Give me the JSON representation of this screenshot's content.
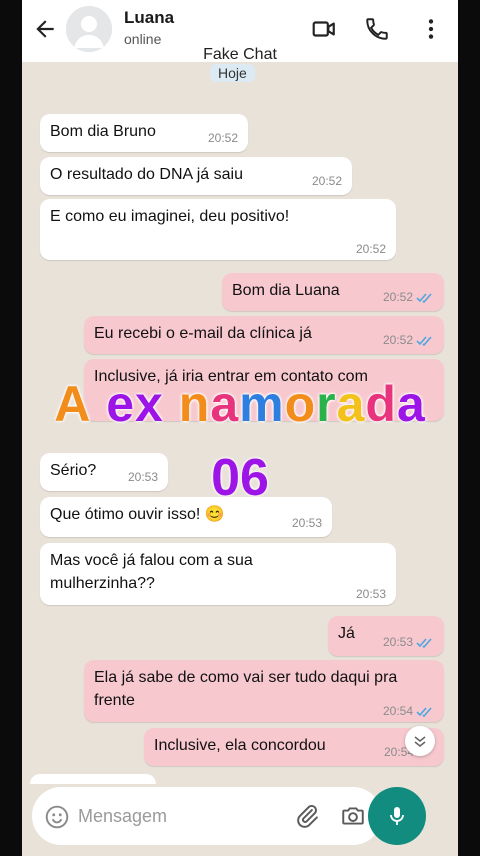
{
  "header": {
    "contact_name": "Luana",
    "status": "online",
    "subtitle": "Fake Chat"
  },
  "date_label": "Hoje",
  "messages": [
    {
      "text": "Bom dia Bruno",
      "time": "20:52",
      "direction": "in"
    },
    {
      "text": "O resultado do DNA já saiu",
      "time": "20:52",
      "direction": "in"
    },
    {
      "text": "E como eu imaginei, deu positivo!",
      "time": "20:52",
      "direction": "in"
    },
    {
      "text": "Bom dia Luana",
      "time": "20:52",
      "direction": "out",
      "read": true
    },
    {
      "text": "Eu recebi o e-mail da clínica já",
      "time": "20:52",
      "direction": "out",
      "read": true
    },
    {
      "text": "Inclusive, já iria entrar em contato com",
      "time": "",
      "direction": "out"
    },
    {
      "text": "Sério?",
      "time": "20:53",
      "direction": "in"
    },
    {
      "text": "Que ótimo ouvir isso! 😊",
      "time": "20:53",
      "direction": "in"
    },
    {
      "text": "Mas você já falou com a sua mulherzinha??",
      "time": "20:53",
      "direction": "in"
    },
    {
      "text": "Já",
      "time": "20:53",
      "direction": "out",
      "read": true
    },
    {
      "text": "Ela já sabe de como vai ser tudo daqui pra frente",
      "time": "20:54",
      "direction": "out",
      "read": true
    },
    {
      "text": "Inclusive, ela concordou",
      "time": "20:54",
      "direction": "out"
    }
  ],
  "overlay": {
    "title_letters": [
      {
        "char": "A",
        "color": "#f28c1a"
      },
      {
        "char": " ",
        "color": "#ffffff"
      },
      {
        "char": "e",
        "color": "#9d14e6"
      },
      {
        "char": "x",
        "color": "#9d14e6"
      },
      {
        "char": " ",
        "color": "#ffffff"
      },
      {
        "char": "n",
        "color": "#f28c1a"
      },
      {
        "char": "a",
        "color": "#e8347c"
      },
      {
        "char": "m",
        "color": "#2f7fe0"
      },
      {
        "char": "o",
        "color": "#f28c1a"
      },
      {
        "char": "r",
        "color": "#29b24a"
      },
      {
        "char": "a",
        "color": "#f2c21a"
      },
      {
        "char": "d",
        "color": "#e8347c"
      },
      {
        "char": "a",
        "color": "#9d14e6"
      }
    ],
    "episode": "06"
  },
  "input": {
    "placeholder": "Mensagem"
  },
  "colors": {
    "chat_background": "#e9e2d9",
    "incoming_bubble": "#ffffff",
    "outgoing_bubble": "#f7c9cf",
    "read_ticks": "#4fa6e0",
    "mic_button": "#128c7e"
  },
  "icons": [
    "back-arrow-icon",
    "avatar-icon",
    "video-call-icon",
    "phone-call-icon",
    "more-vert-icon",
    "emoji-icon",
    "attach-icon",
    "camera-icon",
    "mic-icon",
    "chevron-down-icon"
  ]
}
